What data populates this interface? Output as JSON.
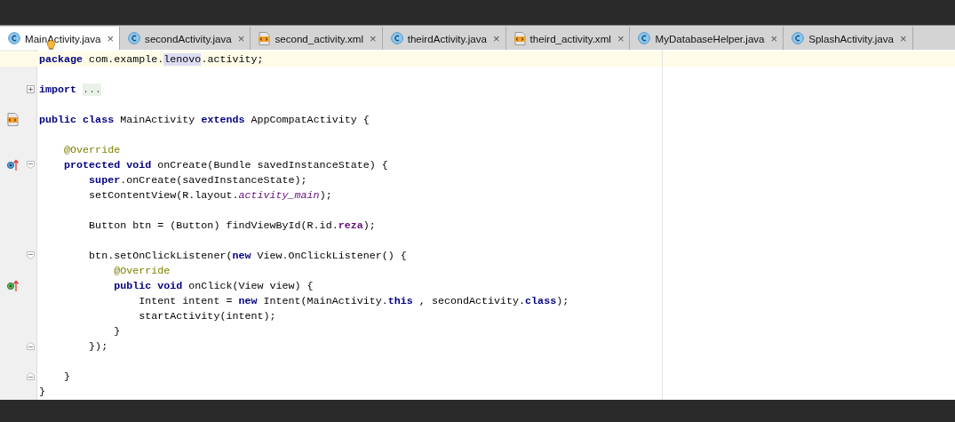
{
  "tabs": [
    {
      "label": "MainActivity.java",
      "kind": "class",
      "close": "×",
      "selected": true
    },
    {
      "label": "secondActivity.java",
      "kind": "class",
      "close": "×",
      "selected": false
    },
    {
      "label": "second_activity.xml",
      "kind": "xml",
      "close": "×",
      "selected": false
    },
    {
      "label": "theirdActivity.java",
      "kind": "class",
      "close": "×",
      "selected": false
    },
    {
      "label": "theird_activity.xml",
      "kind": "xml",
      "close": "×",
      "selected": false
    },
    {
      "label": "MyDatabaseHelper.java",
      "kind": "class",
      "close": "×",
      "selected": false
    },
    {
      "label": "SplashActivity.java",
      "kind": "class",
      "close": "×",
      "selected": false
    }
  ],
  "editor": {
    "lines": [
      {
        "kind": "code",
        "current": true,
        "tokens": [
          {
            "kind": "kw",
            "text": "package"
          },
          {
            "kind": "plain",
            "text": " com.example."
          },
          {
            "kind": "match",
            "text": "lenovo"
          },
          {
            "kind": "plain",
            "text": ".activity;"
          }
        ]
      },
      {
        "kind": "blank"
      },
      {
        "kind": "code",
        "fold": {
          "kind": "expand"
        },
        "tokens": [
          {
            "kind": "kw",
            "text": "import"
          },
          {
            "kind": "folded",
            "text": "..."
          }
        ]
      },
      {
        "kind": "blank"
      },
      {
        "kind": "code",
        "marker": {
          "kind": "xml"
        },
        "tokens": [
          {
            "kind": "kw",
            "text": "public class"
          },
          {
            "kind": "plain",
            "text": " MainActivity "
          },
          {
            "kind": "kw",
            "text": "extends"
          },
          {
            "kind": "plain",
            "text": " AppCompatActivity {"
          }
        ]
      },
      {
        "kind": "blank"
      },
      {
        "kind": "code",
        "tokens": [
          {
            "kind": "ann",
            "text": "    @Override"
          }
        ]
      },
      {
        "kind": "code",
        "marker": {
          "kind": "override"
        },
        "fold": {
          "kind": "collapse"
        },
        "tokens": [
          {
            "kind": "kw",
            "text": "    protected void"
          },
          {
            "kind": "plain",
            "text": " onCreate(Bundle savedInstanceState) {"
          }
        ]
      },
      {
        "kind": "code",
        "tokens": [
          {
            "kind": "kw",
            "text": "        super"
          },
          {
            "kind": "plain",
            "text": ".onCreate(savedInstanceState);"
          }
        ]
      },
      {
        "kind": "code",
        "tokens": [
          {
            "kind": "plain",
            "text": "        setContentView(R.layout."
          },
          {
            "kind": "field",
            "text": "activity_main"
          },
          {
            "kind": "plain",
            "text": ");"
          }
        ]
      },
      {
        "kind": "blank"
      },
      {
        "kind": "code",
        "tokens": [
          {
            "kind": "plain",
            "text": "        Button btn = (Button) findViewById(R.id."
          },
          {
            "kind": "constant",
            "text": "reza"
          },
          {
            "kind": "plain",
            "text": ");"
          }
        ]
      },
      {
        "kind": "blank"
      },
      {
        "kind": "code",
        "fold": {
          "kind": "collapse"
        },
        "tokens": [
          {
            "kind": "plain",
            "text": "        btn.setOnClickListener("
          },
          {
            "kind": "kw",
            "text": "new"
          },
          {
            "kind": "plain",
            "text": " View.OnClickListener() {"
          }
        ]
      },
      {
        "kind": "code",
        "tokens": [
          {
            "kind": "ann",
            "text": "            @Override"
          }
        ]
      },
      {
        "kind": "code",
        "marker": {
          "kind": "implement"
        },
        "tokens": [
          {
            "kind": "kw",
            "text": "            public void"
          },
          {
            "kind": "plain",
            "text": " onClick(View view) {"
          }
        ]
      },
      {
        "kind": "code",
        "tokens": [
          {
            "kind": "plain",
            "text": "                Intent intent = "
          },
          {
            "kind": "kw",
            "text": "new"
          },
          {
            "kind": "plain",
            "text": " Intent(MainActivity."
          },
          {
            "kind": "kw",
            "text": "this"
          },
          {
            "kind": "plain",
            "text": " , secondActivity."
          },
          {
            "kind": "kw",
            "text": "class"
          },
          {
            "kind": "plain",
            "text": ");"
          }
        ]
      },
      {
        "kind": "code",
        "tokens": [
          {
            "kind": "plain",
            "text": "                startActivity(intent);"
          }
        ]
      },
      {
        "kind": "code",
        "tokens": [
          {
            "kind": "plain",
            "text": "            }"
          }
        ]
      },
      {
        "kind": "code",
        "fold": {
          "kind": "end"
        },
        "tokens": [
          {
            "kind": "plain",
            "text": "        });"
          }
        ]
      },
      {
        "kind": "blank"
      },
      {
        "kind": "code",
        "fold": {
          "kind": "end"
        },
        "tokens": [
          {
            "kind": "plain",
            "text": "    }"
          }
        ]
      },
      {
        "kind": "code",
        "tokens": [
          {
            "kind": "plain",
            "text": "}"
          }
        ]
      }
    ]
  }
}
